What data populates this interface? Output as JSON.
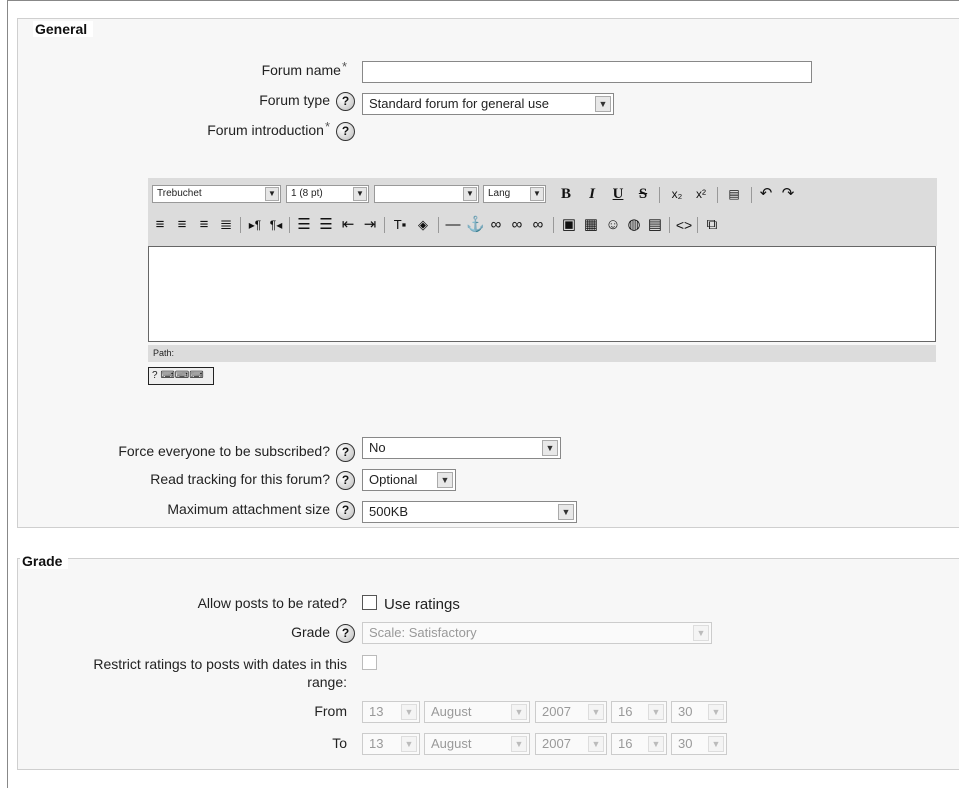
{
  "general": {
    "legend": "General",
    "forum_name": {
      "label": "Forum name",
      "required": "*",
      "value": ""
    },
    "forum_type": {
      "label": "Forum type",
      "selected": "Standard forum for general use"
    },
    "intro": {
      "label": "Forum introduction",
      "required": "*"
    },
    "editor": {
      "font": "Trebuchet",
      "size": "1 (8 pt)",
      "format": "",
      "lang": "Lang",
      "path_label": "Path:"
    },
    "subscribe": {
      "label": "Force everyone to be subscribed?",
      "selected": "No"
    },
    "tracking": {
      "label": "Read tracking for this forum?",
      "selected": "Optional"
    },
    "attachment": {
      "label": "Maximum attachment size",
      "selected": "500KB"
    }
  },
  "grade": {
    "legend": "Grade",
    "allow_rate": {
      "label": "Allow posts to be rated?",
      "checkbox_label": "Use ratings"
    },
    "grade": {
      "label": "Grade",
      "selected": "Scale: Satisfactory"
    },
    "restrict": {
      "label_line1": "Restrict ratings to posts with dates in this",
      "label_line2": "range:"
    },
    "from": {
      "label": "From",
      "day": "13",
      "month": "August",
      "year": "2007",
      "hour": "16",
      "minute": "30"
    },
    "to": {
      "label": "To",
      "day": "13",
      "month": "August",
      "year": "2007",
      "hour": "16",
      "minute": "30"
    }
  },
  "help_glyph": "?",
  "icons": [
    "help-icon",
    "bold-icon",
    "italic-icon",
    "underline-icon",
    "strikethrough-icon",
    "subscript-icon",
    "superscript-icon",
    "undo-icon",
    "redo-icon",
    "link-icon",
    "image-icon",
    "table-icon",
    "smiley-icon",
    "html-source-icon",
    "fullscreen-icon",
    "keyboard-icon"
  ]
}
